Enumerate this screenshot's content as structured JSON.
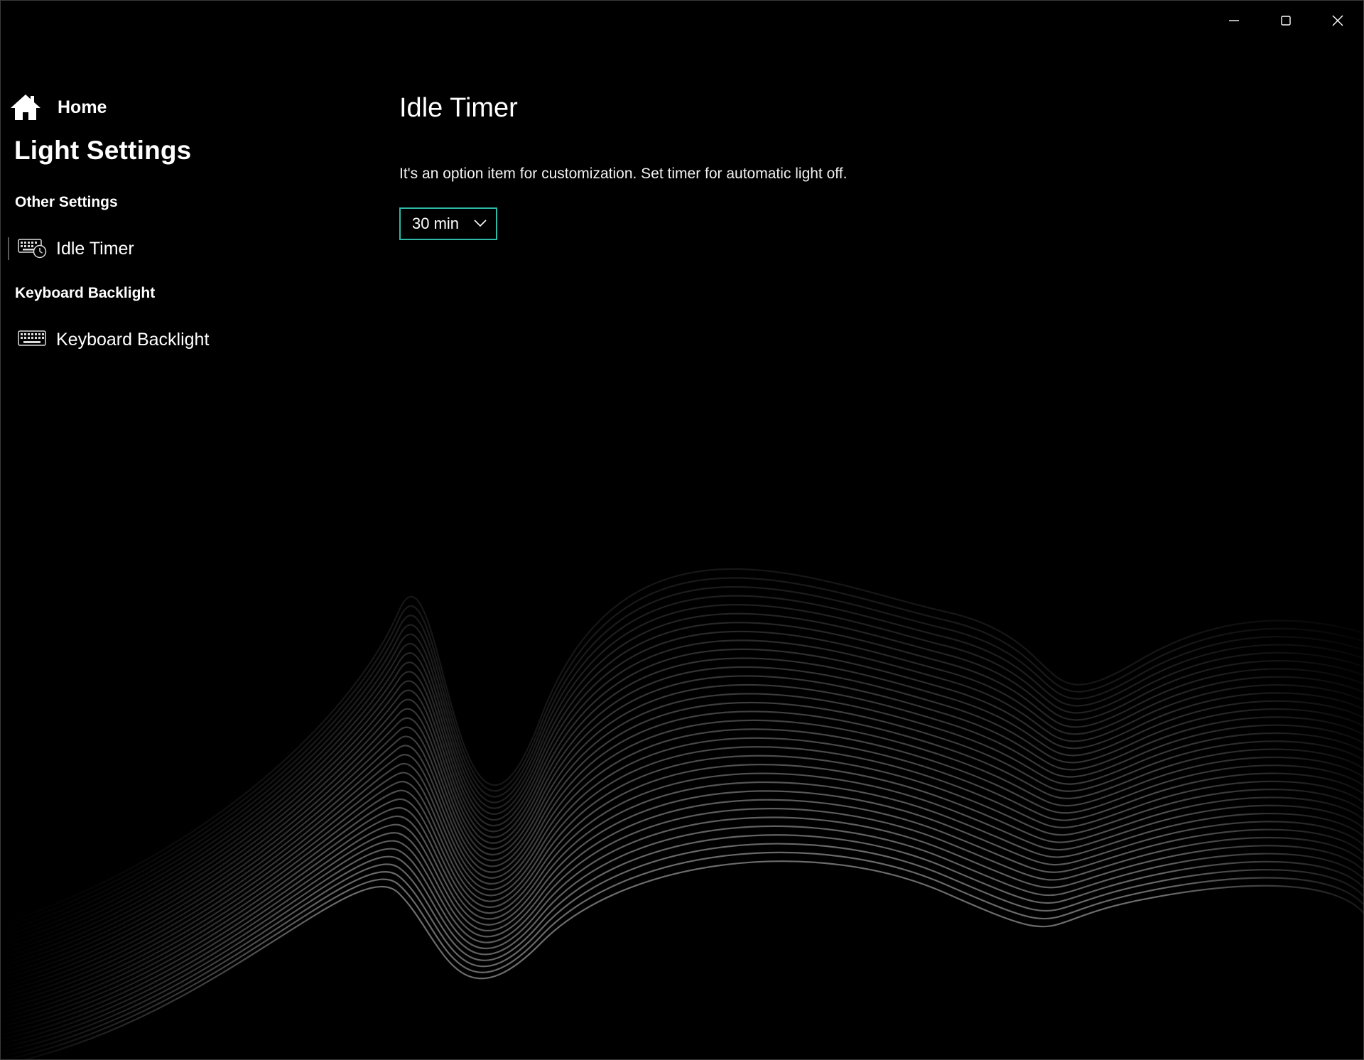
{
  "window": {
    "controls": {
      "minimize_icon": "minimize-icon",
      "maximize_icon": "maximize-icon",
      "close_icon": "close-icon"
    }
  },
  "sidebar": {
    "home": {
      "icon": "home-icon",
      "label": "Home"
    },
    "app_title": "Light Settings",
    "sections": [
      {
        "heading": "Other Settings",
        "items": [
          {
            "icon": "keyboard-timer-icon",
            "label": "Idle Timer",
            "selected": true
          }
        ]
      },
      {
        "heading": "Keyboard Backlight",
        "items": [
          {
            "icon": "keyboard-icon",
            "label": "Keyboard Backlight",
            "selected": false
          }
        ]
      }
    ]
  },
  "main": {
    "title": "Idle Timer",
    "description": "It's an option item for customization. Set timer for automatic light off.",
    "timer_select": {
      "value": "30 min",
      "chevron_icon": "chevron-down-icon"
    }
  },
  "colors": {
    "background": "#000000",
    "accent_border": "#2db9a6",
    "text": "#ffffff",
    "wave_lines": "#9a9a9a"
  }
}
